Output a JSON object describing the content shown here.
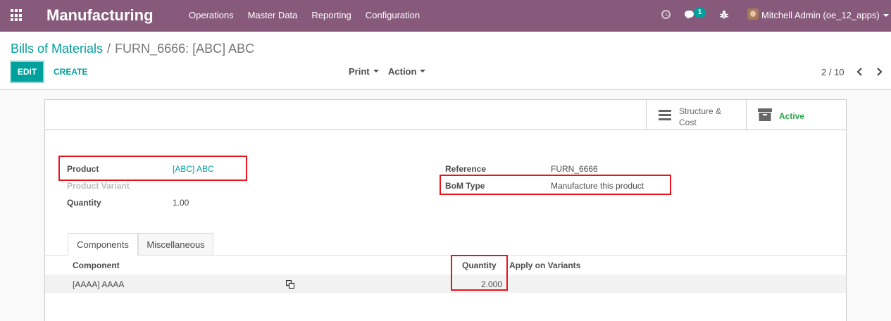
{
  "navbar": {
    "app_title": "Manufacturing",
    "menu": [
      "Operations",
      "Master Data",
      "Reporting",
      "Configuration"
    ],
    "messages_count": "1",
    "user_label": "Mitchell Admin (oe_12_apps)",
    "accent_color": "#875a7b"
  },
  "breadcrumb": {
    "parent": "Bills of Materials",
    "separator": "/",
    "current": "FURN_6666: [ABC] ABC"
  },
  "toolbar": {
    "edit_label": "EDIT",
    "create_label": "CREATE",
    "print_label": "Print",
    "action_label": "Action",
    "pager": "2 / 10"
  },
  "smart_buttons": {
    "structure_cost_line1": "Structure &",
    "structure_cost_line2": "Cost",
    "active_label": "Active"
  },
  "form": {
    "product_label": "Product",
    "product_value": "[ABC] ABC",
    "variant_label": "Product Variant",
    "quantity_label": "Quantity",
    "quantity_value": "1.00",
    "reference_label": "Reference",
    "reference_value": "FURN_6666",
    "bom_type_label": "BoM Type",
    "bom_type_value": "Manufacture this product"
  },
  "tabs": [
    "Components",
    "Miscellaneous"
  ],
  "components_table": {
    "headers": [
      "Component",
      "Quantity",
      "Apply on Variants"
    ],
    "rows": [
      {
        "component": "[AAAA] AAAA",
        "quantity": "2.000",
        "variants": ""
      }
    ]
  },
  "colors": {
    "primary": "#00a09d",
    "highlight_box": "#e8141c",
    "active_green": "#28a745"
  }
}
